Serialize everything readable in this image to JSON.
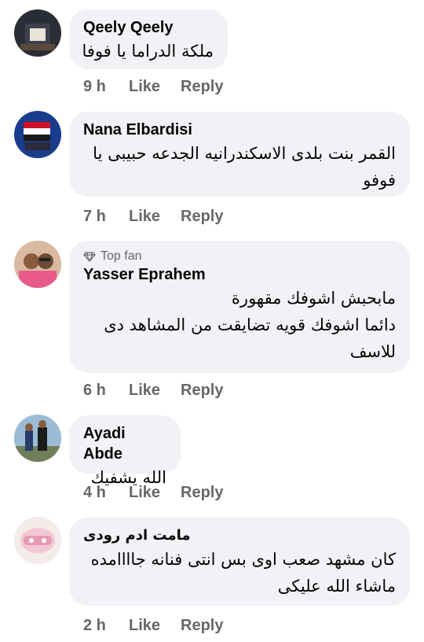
{
  "comments": [
    {
      "author": "Qeely Qeely",
      "top_fan": "",
      "lines": [
        "ملكة الدراما يا فوفا"
      ],
      "time": "9 h",
      "like": "Like",
      "reply": "Reply"
    },
    {
      "author": "Nana Elbardisi",
      "top_fan": "",
      "lines": [
        "القمر بنت بلدى الاسكندرانيه الجدعه حبيبى يا",
        "فوفو"
      ],
      "time": "7 h",
      "like": "Like",
      "reply": "Reply"
    },
    {
      "author": "Yasser Eprahem",
      "top_fan": "Top fan",
      "lines": [
        "مابحبش اشوفك مقهورة",
        "دائما اشوفك قويه تضايقت من المشاهد دى",
        "للاسف"
      ],
      "time": "6 h",
      "like": "Like",
      "reply": "Reply"
    },
    {
      "author": "Ayadi Abde",
      "top_fan": "",
      "lines": [
        "الله يشفيك"
      ],
      "time": "4 h",
      "like": "Like",
      "reply": "Reply"
    },
    {
      "author": "مامت ادم رودى",
      "top_fan": "",
      "lines": [
        "كان مشهد صعب اوى بس انتى فنانه جاااامده",
        "ماشاء الله عليكى"
      ],
      "time": "2 h",
      "like": "Like",
      "reply": "Reply"
    }
  ]
}
